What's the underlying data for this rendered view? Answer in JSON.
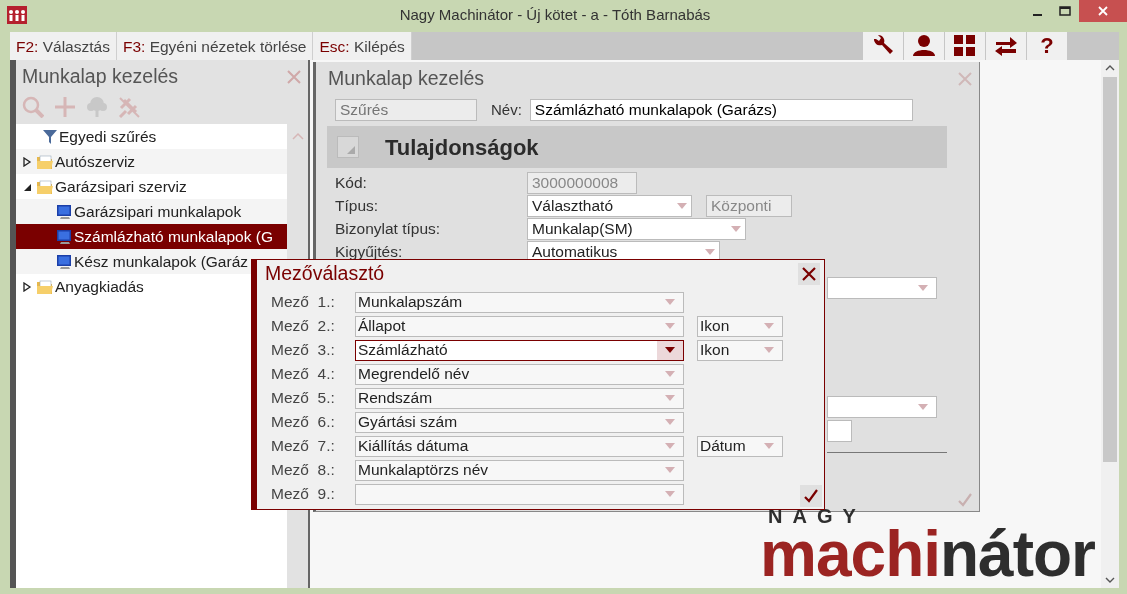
{
  "window": {
    "title": "Nagy Machinátor - Új kötet - a - Tóth Barnabás"
  },
  "shortcuts": [
    {
      "key": "F2:",
      "label": "Választás"
    },
    {
      "key": "F3:",
      "label": "Egyéni nézetek törlése"
    },
    {
      "key": "Esc:",
      "label": "Kilépés"
    }
  ],
  "toolbar": [
    {
      "kind": "wrench"
    },
    {
      "kind": "user"
    },
    {
      "kind": "grid"
    },
    {
      "kind": "swap"
    },
    {
      "kind": "help",
      "text": "?"
    }
  ],
  "left_panel": {
    "title": "Munkalap kezelés",
    "tools": [
      {
        "kind": "search",
        "disabled": true
      },
      {
        "kind": "add",
        "disabled": true
      },
      {
        "kind": "tree",
        "disabled": true
      },
      {
        "kind": "pin",
        "disabled": true
      }
    ],
    "tree": [
      {
        "label": "Egyedi szűrés",
        "kind": "filter",
        "selected": false
      },
      {
        "label": "Autószerviz",
        "kind": "folder",
        "expanded": false,
        "selected": false
      },
      {
        "label": "Garázsipari szerviz",
        "kind": "folder",
        "expanded": true,
        "selected": false,
        "children": [
          {
            "label": "Garázsipari munkalapok",
            "kind": "view",
            "selected": false
          },
          {
            "label": "Számlázható munkalapok (G",
            "kind": "view",
            "selected": true
          },
          {
            "label": "Kész munkalapok (Garáz",
            "kind": "view",
            "selected": false
          }
        ]
      },
      {
        "label": "Anyagkiadás",
        "kind": "folder",
        "expanded": false,
        "selected": false
      }
    ]
  },
  "main_panel": {
    "title": "Munkalap kezelés",
    "filter": {
      "placeholder": "Szűrés"
    },
    "name_label": "Név:",
    "name_value": "Számlázható munkalapok (Garázs)",
    "section": {
      "title": "Tulajdonságok"
    },
    "properties": [
      {
        "label": "Kód:",
        "kind": "readonly",
        "value": "3000000008"
      },
      {
        "label": "Típus:",
        "kind": "select",
        "value": "Választható",
        "extra": "Központi"
      },
      {
        "label": "Bizonylat típus:",
        "kind": "select",
        "value": "Munkalap(SM)"
      },
      {
        "label": "Kigyűjtés:",
        "kind": "select",
        "value": "Automatikus"
      }
    ]
  },
  "dialog": {
    "title": "Mezőválasztó",
    "rows": [
      {
        "label": "Mező  1.:",
        "value": "Munkalapszám",
        "focused": false
      },
      {
        "label": "Mező  2.:",
        "value": "Állapot",
        "focused": false,
        "format": "Ikon"
      },
      {
        "label": "Mező  3.:",
        "value": "Számlázható",
        "focused": true,
        "format": "Ikon"
      },
      {
        "label": "Mező  4.:",
        "value": "Megrendelő név",
        "focused": false
      },
      {
        "label": "Mező  5.:",
        "value": "Rendszám",
        "focused": false
      },
      {
        "label": "Mező  6.:",
        "value": "Gyártási szám",
        "focused": false
      },
      {
        "label": "Mező  7.:",
        "value": "Kiállítás dátuma",
        "focused": false,
        "format": "Dátum"
      },
      {
        "label": "Mező  8.:",
        "value": "Munkalaptörzs név",
        "focused": false
      },
      {
        "label": "Mező  9.:",
        "focused": false
      }
    ]
  },
  "logo": {
    "top": "NAGY",
    "parts": [
      {
        "text": "machi",
        "color": "#9b2422"
      },
      {
        "text": "nátor",
        "color": "#2e2e2e"
      }
    ]
  }
}
